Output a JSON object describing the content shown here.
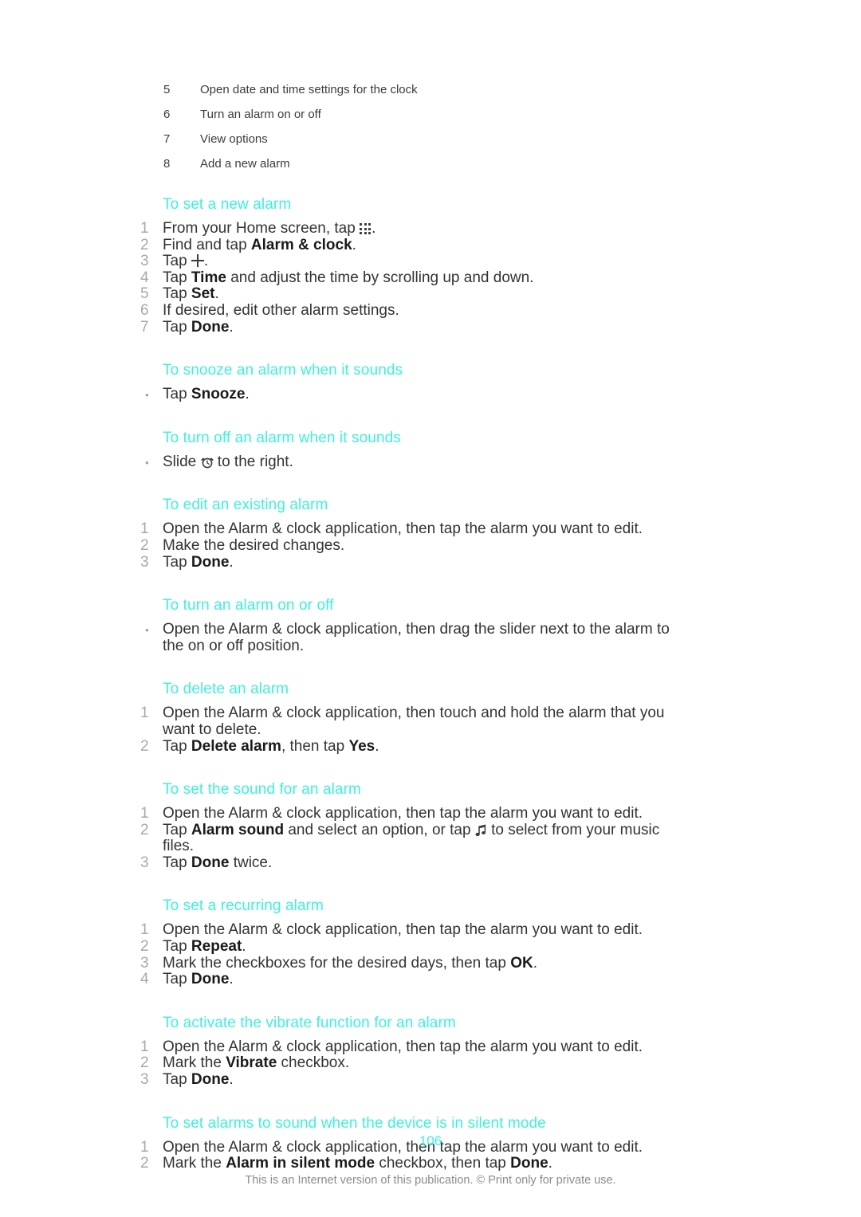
{
  "page": {
    "number": "106",
    "footer_note": "This is an Internet version of this publication. © Print only for private use."
  },
  "legend": {
    "rows": [
      {
        "num": "5",
        "text": "Open date and time settings for the clock"
      },
      {
        "num": "6",
        "text": "Turn an alarm on or off"
      },
      {
        "num": "7",
        "text": "View options"
      },
      {
        "num": "8",
        "text": "Add a new alarm"
      }
    ]
  },
  "sections": [
    {
      "heading": "To set a new alarm",
      "list_type": "ordered",
      "steps": [
        {
          "num": "1",
          "pre": "From your Home screen, tap ",
          "icon": "app-drawer-icon",
          "post": "."
        },
        {
          "num": "2",
          "pre": "Find and tap ",
          "bold": "Alarm & clock",
          "post": "."
        },
        {
          "num": "3",
          "pre": "Tap ",
          "icon": "plus-icon",
          "post": "."
        },
        {
          "num": "4",
          "pre": "Tap ",
          "bold": "Time",
          "post": " and adjust the time by scrolling up and down."
        },
        {
          "num": "5",
          "pre": "Tap ",
          "bold": "Set",
          "post": "."
        },
        {
          "num": "6",
          "pre": "If desired, edit other alarm settings.",
          "post": ""
        },
        {
          "num": "7",
          "pre": "Tap ",
          "bold": "Done",
          "post": "."
        }
      ]
    },
    {
      "heading": "To snooze an alarm when it sounds",
      "list_type": "bullet",
      "steps": [
        {
          "num": "•",
          "pre": "Tap ",
          "bold": "Snooze",
          "post": "."
        }
      ]
    },
    {
      "heading": "To turn off an alarm when it sounds",
      "list_type": "bullet",
      "steps": [
        {
          "num": "•",
          "pre": "Slide ",
          "icon": "alarm-clock-icon",
          "post": " to the right."
        }
      ]
    },
    {
      "heading": "To edit an existing alarm",
      "list_type": "ordered",
      "steps": [
        {
          "num": "1",
          "pre": "Open the Alarm & clock application, then tap the alarm you want to edit.",
          "post": ""
        },
        {
          "num": "2",
          "pre": "Make the desired changes.",
          "post": ""
        },
        {
          "num": "3",
          "pre": "Tap ",
          "bold": "Done",
          "post": "."
        }
      ]
    },
    {
      "heading": "To turn an alarm on or off",
      "list_type": "bullet",
      "steps": [
        {
          "num": "•",
          "pre": "Open the Alarm & clock application, then drag the slider next to the alarm to the on or off position.",
          "post": ""
        }
      ]
    },
    {
      "heading": "To delete an alarm",
      "list_type": "ordered",
      "steps": [
        {
          "num": "1",
          "pre": "Open the Alarm & clock application, then touch and hold the alarm that you want to delete.",
          "post": ""
        },
        {
          "num": "2",
          "pre": "Tap ",
          "bold": "Delete alarm",
          "mid": ", then tap ",
          "bold2": "Yes",
          "post": "."
        }
      ]
    },
    {
      "heading": "To set the sound for an alarm",
      "list_type": "ordered",
      "steps": [
        {
          "num": "1",
          "pre": "Open the Alarm & clock application, then tap the alarm you want to edit.",
          "post": ""
        },
        {
          "num": "2",
          "pre": "Tap ",
          "bold": "Alarm sound",
          "mid": " and select an option, or tap ",
          "icon": "music-note-icon",
          "post": " to select from your music files."
        },
        {
          "num": "3",
          "pre": "Tap ",
          "bold": "Done",
          "post": " twice."
        }
      ]
    },
    {
      "heading": "To set a recurring alarm",
      "list_type": "ordered",
      "steps": [
        {
          "num": "1",
          "pre": "Open the Alarm & clock application, then tap the alarm you want to edit.",
          "post": ""
        },
        {
          "num": "2",
          "pre": "Tap ",
          "bold": "Repeat",
          "post": "."
        },
        {
          "num": "3",
          "pre": "Mark the checkboxes for the desired days, then tap ",
          "bold": "OK",
          "post": "."
        },
        {
          "num": "4",
          "pre": "Tap ",
          "bold": "Done",
          "post": "."
        }
      ]
    },
    {
      "heading": "To activate the vibrate function for an alarm",
      "list_type": "ordered",
      "steps": [
        {
          "num": "1",
          "pre": "Open the Alarm & clock application, then tap the alarm you want to edit.",
          "post": ""
        },
        {
          "num": "2",
          "pre": "Mark the ",
          "bold": "Vibrate",
          "post": " checkbox."
        },
        {
          "num": "3",
          "pre": "Tap ",
          "bold": "Done",
          "post": "."
        }
      ]
    },
    {
      "heading": "To set alarms to sound when the device is in silent mode",
      "list_type": "ordered",
      "steps": [
        {
          "num": "1",
          "pre": "Open the Alarm & clock application, then tap the alarm you want to edit.",
          "post": ""
        },
        {
          "num": "2",
          "pre": "Mark the ",
          "bold": "Alarm in silent mode",
          "mid": " checkbox, then tap ",
          "bold2": "Done",
          "post": "."
        }
      ]
    }
  ],
  "colors": {
    "heading": "#3ef0dc",
    "body_text": "#333333",
    "marker": "#a8a8a8",
    "footer": "#8c8c8c"
  }
}
